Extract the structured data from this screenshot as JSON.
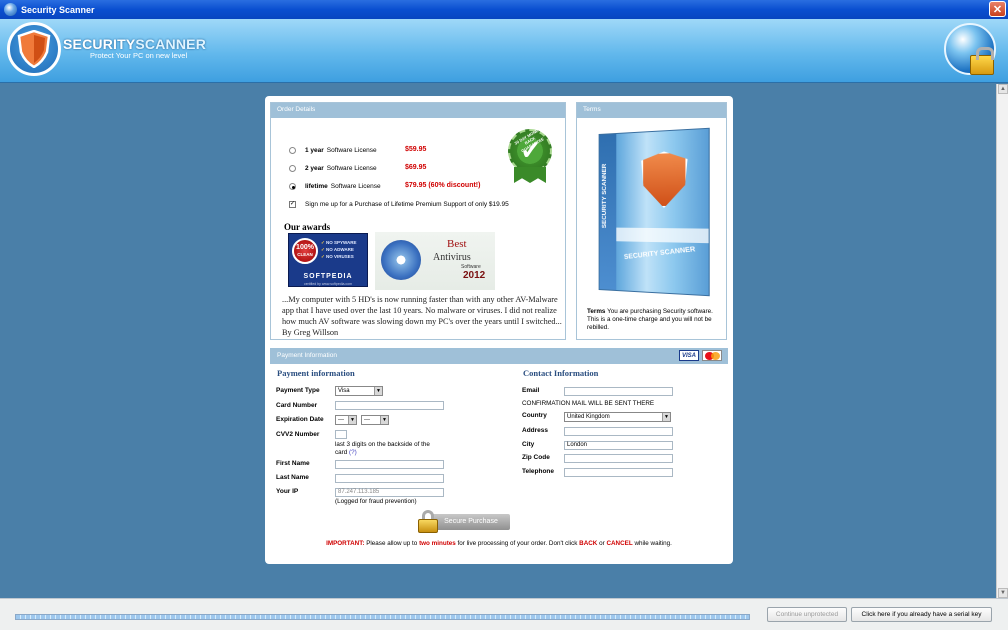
{
  "window": {
    "title": "Security Scanner"
  },
  "header": {
    "brand_part1": "SECURITY",
    "brand_part2": "SCANNER",
    "tagline": "Protect Your PC on new level"
  },
  "order": {
    "section_title": "Order Details",
    "options": [
      {
        "term": "1 year",
        "desc": "Software License",
        "price": "$59.95",
        "selected": false
      },
      {
        "term": "2 year",
        "desc": "Software License",
        "price": "$69.95",
        "selected": false
      },
      {
        "term": "lifetime",
        "desc": "Software License",
        "price": "$79.95 (60% discount!)",
        "selected": true
      }
    ],
    "support_checkbox_label": "Sign me up for a Purchase of Lifetime Premium Support of only $19.95",
    "support_checked": true,
    "guarantee_badge": "30 DAY MONEY BACK GUARANTEE",
    "awards_title": "Our awards",
    "softpedia": {
      "badge_top": "100%",
      "badge_bottom": "CLEAN",
      "lines": [
        "NO SPYWARE",
        "NO ADWARE",
        "NO VIRUSES"
      ],
      "name": "SOFTPEDIA",
      "cert": "certified by www.softpedia.com"
    },
    "best_antivirus": {
      "line1": "Best",
      "line2": "Antivirus",
      "line3": "Software",
      "year": "2012"
    },
    "testimonial": "...My computer with 5 HD's is now running faster than with any other AV-Malware app that I have used over the last 10 years. No malware or viruses. I did not realize how much AV software was slowing down my PC's over the years until I switched... By Greg Willson"
  },
  "terms": {
    "section_title": "Terms",
    "box_spine": "SECURITY SCANNER",
    "box_name": "SECURITY SCANNER",
    "label": "Terms",
    "text": "You are purchasing Security software. This is a one-time charge and you will not be rebilled."
  },
  "payment": {
    "section_title": "Payment Information",
    "card_logos": [
      "VISA",
      "MasterCard"
    ],
    "left_title": "Payment information",
    "payment_type_label": "Payment Type",
    "payment_type_value": "Visa",
    "card_number_label": "Card Number",
    "card_number_value": "",
    "expiration_label": "Expiration Date",
    "exp_month": "---",
    "exp_year": "---",
    "cvv_label": "CVV2 Number",
    "cvv_value": "",
    "cvv_hint": "last 3 digits on the backside of the card",
    "cvv_help": "(?)",
    "first_name_label": "First Name",
    "first_name_value": "",
    "last_name_label": "Last Name",
    "last_name_value": "",
    "ip_label": "Your IP",
    "ip_value": "87.247.113.185",
    "ip_note": "(Logged for fraud prevention)",
    "secure_button": "Secure Purchase"
  },
  "contact": {
    "title": "Contact Information",
    "email_label": "Email",
    "email_value": "",
    "email_note": "CONFIRMATION MAIL WILL BE SENT THERE",
    "country_label": "Country",
    "country_value": "United Kingdom",
    "address_label": "Address",
    "address_value": "",
    "city_label": "City",
    "city_value": "London",
    "zip_label": "Zip Code",
    "zip_value": "",
    "phone_label": "Telephone",
    "phone_value": ""
  },
  "important": {
    "label": "IMPORTANT:",
    "text1": " Please allow up to ",
    "emph1": "two minutes",
    "text2": " for live processing of your order. Don't click ",
    "emph2": "BACK",
    "text3": " or ",
    "emph3": "CANCEL",
    "text4": " while waiting."
  },
  "footer": {
    "continue_unprotected": "Continue unprotected",
    "serial_key": "Click here if you already have a serial key"
  }
}
